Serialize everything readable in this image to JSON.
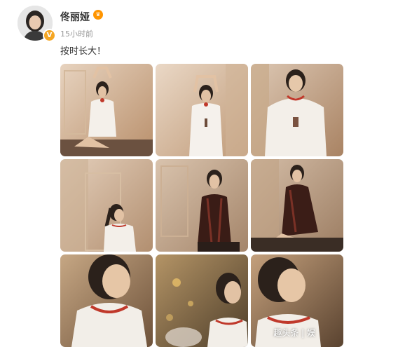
{
  "user": {
    "name": "佟丽娅",
    "verified_badge": "V"
  },
  "post": {
    "time": "15小时前",
    "text": "按时长大！"
  },
  "photos": [
    {
      "subject": "arms-raised-sitting",
      "palette": [
        "#c8a585",
        "#e8d6c4"
      ]
    },
    {
      "subject": "arms-raised-standing",
      "palette": [
        "#c9a889",
        "#ead8c6"
      ]
    },
    {
      "subject": "smiling-seated",
      "palette": [
        "#b89878",
        "#dcc7b3"
      ]
    },
    {
      "subject": "side-profile-ponytail",
      "palette": [
        "#c2a285",
        "#e4cfbb"
      ]
    },
    {
      "subject": "dark-jacket-seated",
      "palette": [
        "#b09476",
        "#d9c3ad"
      ]
    },
    {
      "subject": "dark-jacket-lounge",
      "palette": [
        "#a88b6f",
        "#d4bda7"
      ]
    },
    {
      "subject": "closeup-profile-left",
      "palette": [
        "#8a6a4c",
        "#c6a784"
      ]
    },
    {
      "subject": "closeup-back-city",
      "palette": [
        "#6e5a3e",
        "#b49466"
      ]
    },
    {
      "subject": "closeup-profile-right",
      "palette": [
        "#7a5c40",
        "#c4a07c"
      ]
    }
  ],
  "watermark": "趣头条 | 娱"
}
